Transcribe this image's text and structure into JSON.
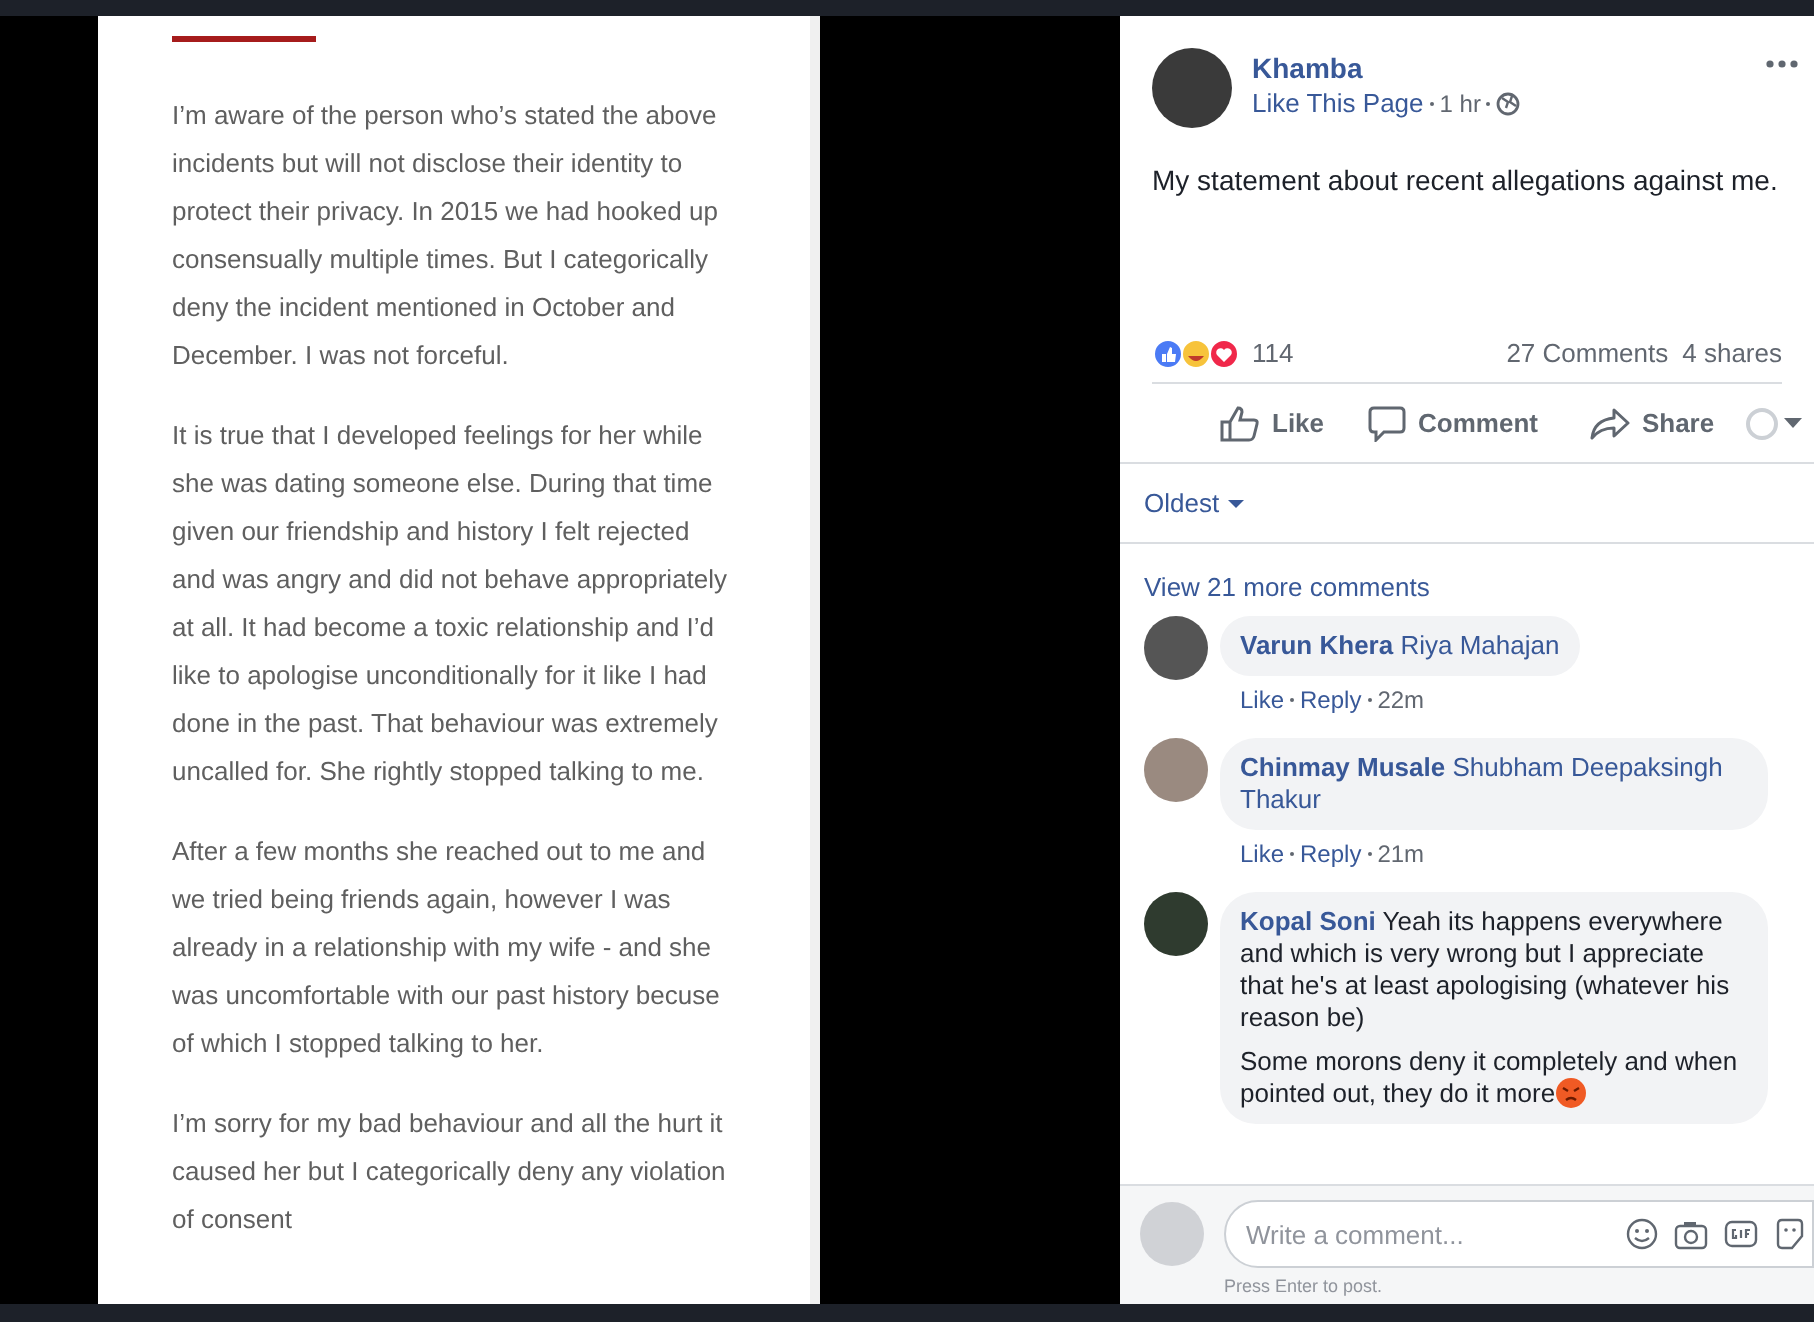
{
  "document": {
    "paragraphs": [
      {
        "lines": [
          "I’m aware of the person who’s stated the above",
          "incidents but will not disclose their identity to",
          "protect their privacy. In 2015 we had hooked up",
          "consensually multiple times. But I categorically",
          "deny the incident mentioned in October and",
          "December. I was not forceful."
        ]
      },
      {
        "lines": [
          "It is true that I developed feelings for her while",
          "she was dating someone else. During that time",
          "given our friendship and history I felt rejected",
          "and was angry and did not behave appropriately",
          "at all. It had become a toxic relationship and I’d",
          "like to apologise unconditionally for it like I had",
          "done in the past. That behaviour was extremely",
          "uncalled for. She rightly stopped talking to me."
        ]
      },
      {
        "lines": [
          "After a few months she reached out to me and",
          "we tried being friends again, however I was",
          "already in a relationship with my wife - and she",
          "was uncomfortable with our past history becuse",
          "of which I stopped talking to her."
        ]
      },
      {
        "lines": [
          "I’m sorry for my bad behaviour and all the hurt it",
          "caused her but I categorically deny any violation",
          "of consent"
        ]
      }
    ]
  },
  "post": {
    "page_name": "Khamba",
    "like_page": "Like This Page",
    "time": "1 hr",
    "text": "My statement about recent allegations against me.",
    "reactions_count": "114",
    "comments_count": "27 Comments",
    "shares": "4 shares",
    "actions": [
      {
        "kind": "like",
        "label": "Like"
      },
      {
        "kind": "comment",
        "label": "Comment"
      },
      {
        "kind": "share",
        "label": "Share"
      }
    ],
    "sort": "Oldest"
  },
  "comments": {
    "view_more": "View 21 more comments",
    "items": [
      {
        "author": "Varun Khera",
        "kind": "mention",
        "paragraphs": [
          "Riya Mahajan"
        ],
        "emoji": false,
        "actions": [
          "Like",
          "Reply"
        ],
        "time": "22m"
      },
      {
        "author": "Chinmay Musale",
        "kind": "mention",
        "paragraphs": [
          "Shubham Deepaksingh Thakur"
        ],
        "emoji": false,
        "actions": [
          "Like",
          "Reply"
        ],
        "time": "21m"
      },
      {
        "author": "Kopal Soni",
        "kind": "text",
        "paragraphs": [
          "Yeah its happens everywhere and which is very wrong but I appreciate that he's at least apologising (whatever his reason be)",
          "Some morons deny it completely and when pointed out, they do it more"
        ],
        "emoji": true
      }
    ]
  },
  "composer": {
    "placeholder": "Write a comment...",
    "hint": "Press Enter to post."
  }
}
